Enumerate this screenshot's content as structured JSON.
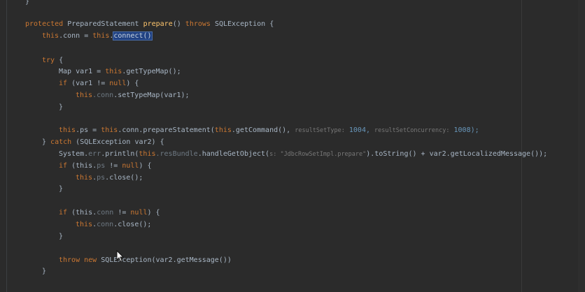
{
  "top_brace": "}",
  "lines": {
    "l1": [
      "protected",
      " PreparedStatement ",
      "prepare",
      "() ",
      "throws",
      " SQLException {"
    ],
    "l2": [
      "this",
      ".conn = ",
      "this",
      ".",
      "connect()"
    ],
    "l3": [
      "try",
      " {"
    ],
    "l4": [
      "Map var1 = ",
      "this",
      ".getTypeMap();"
    ],
    "l5": [
      "if",
      " (var1 != ",
      "null",
      ") {"
    ],
    "l6": [
      "this",
      ".conn",
      ".setTypeMap(var1);"
    ],
    "l7": [
      "}"
    ],
    "l8": [
      "this",
      ".ps = ",
      "this",
      ".conn.prepareStatement(",
      "this",
      ".getCommand(),",
      "resultSetType:",
      " 1004,",
      "resultSetConcurrency:",
      " 1008);"
    ],
    "l9": [
      "} ",
      "catch",
      " (SQLException var2) {"
    ],
    "l10": [
      "System.",
      "err",
      ".println(",
      "this",
      ".resBundle",
      ".handleGetObject(",
      "s:",
      " \"JdbcRowSetImpl.prepare\"",
      ").toString() + var2.getLocalizedMessage());"
    ],
    "l11": [
      "if",
      " (",
      "this",
      ".",
      "ps",
      " != ",
      "null",
      ") {"
    ],
    "l12": [
      "this",
      ".",
      "ps",
      ".close();"
    ],
    "l13": [
      "}"
    ],
    "l14": [
      "if",
      " (",
      "this",
      ".",
      "conn",
      " != ",
      "null",
      ") {"
    ],
    "l15": [
      "this",
      ".",
      "conn",
      ".close();"
    ],
    "l16": [
      "}"
    ],
    "l17": [
      "throw",
      " ",
      "new",
      " SQLException(var2.getMessage())"
    ],
    "l18": [
      "}"
    ]
  }
}
